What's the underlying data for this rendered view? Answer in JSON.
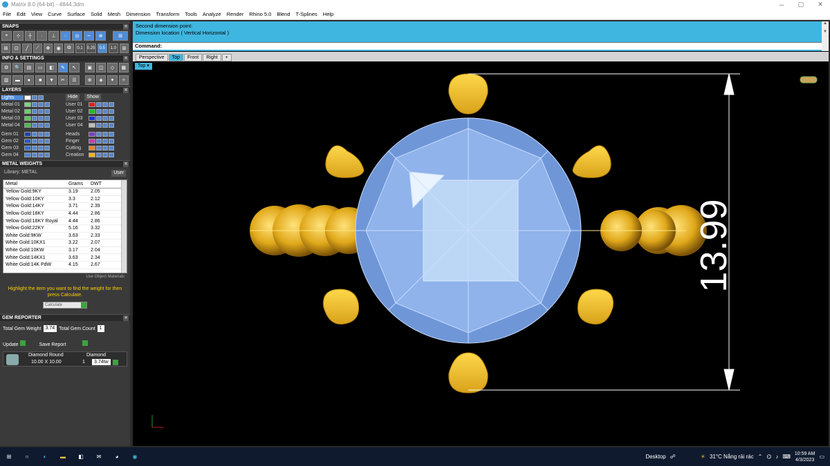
{
  "window": {
    "title": "Matrix 8.0 (64-bit) - 4844.3dm",
    "minimize": "─",
    "maximize": "▢",
    "close": "✕"
  },
  "menu": [
    "File",
    "Edit",
    "View",
    "Curve",
    "Surface",
    "Solid",
    "Mesh",
    "Dimension",
    "Transform",
    "Tools",
    "Analyze",
    "Render",
    "Rhino 5.0",
    "Blend",
    "T-Splines",
    "Help"
  ],
  "panels": {
    "snaps": {
      "title": "SNAPS",
      "values": [
        "0.1",
        "0.25",
        "0.5",
        "1.0"
      ]
    },
    "info": {
      "title": "INFO & SETTINGS"
    },
    "layers": {
      "title": "LAYERS",
      "lights": "Lights",
      "hide": "Hide",
      "show": "Show",
      "left": [
        {
          "name": "Metal 01",
          "color": "#7fd27f"
        },
        {
          "name": "Metal 02",
          "color": "#6ccf6c"
        },
        {
          "name": "Metal 03",
          "color": "#59c659"
        },
        {
          "name": "Metal 04",
          "color": "#4cbc4c"
        },
        {
          "name": "Gem 01",
          "color": "#1f3fc1"
        },
        {
          "name": "Gem 02",
          "color": "#2c58c9"
        },
        {
          "name": "Gem 03",
          "color": "#3a6fd2"
        },
        {
          "name": "Gem 04",
          "color": "#4f85db"
        }
      ],
      "right": [
        {
          "name": "User 01",
          "color": "#e02020"
        },
        {
          "name": "User 02",
          "color": "#20c020"
        },
        {
          "name": "User 03",
          "color": "#2030d0"
        },
        {
          "name": "User 04",
          "color": "#bdbdbd"
        },
        {
          "name": "Heads",
          "color": "#7b3fc4"
        },
        {
          "name": "Finger",
          "color": "#c23fb2"
        },
        {
          "name": "Cutting",
          "color": "#e8842a"
        },
        {
          "name": "Creation",
          "color": "#f2b21c"
        }
      ]
    },
    "metal_weights": {
      "title": "METAL WEIGHTS",
      "library_label": "Library: METAL",
      "user_btn": "User",
      "headers": [
        "Metal",
        "Grams",
        "DWT"
      ],
      "rows": [
        [
          "Yellow Gold:9KY",
          "3.19",
          "2.05"
        ],
        [
          "Yellow Gold:10KY",
          "3.3",
          "2.12"
        ],
        [
          "Yellow Gold:14KY",
          "3.71",
          "2.39"
        ],
        [
          "Yellow Gold:18KY",
          "4.44",
          "2.86"
        ],
        [
          "Yellow Gold:18KY Royal",
          "4.44",
          "2.86"
        ],
        [
          "Yellow Gold:22KY",
          "5.16",
          "3.32"
        ],
        [
          "White Gold:9KW",
          "3.63",
          "2.33"
        ],
        [
          "White Gold:10KX1",
          "3.22",
          "2.07"
        ],
        [
          "White Gold:10KW",
          "3.17",
          "2.04"
        ],
        [
          "White Gold:14KX1",
          "3.63",
          "2.34"
        ],
        [
          "White Gold:14K PdW",
          "4.15",
          "2.67"
        ]
      ],
      "use_object": "Use Object Materials",
      "hint": "Highlight the item you want to find the weight for then press Calculate.",
      "calculate": "Calculate"
    },
    "gem_reporter": {
      "title": "GEM REPORTER",
      "total_weight_label": "Total Gem Weight",
      "total_weight": "3.74",
      "total_count_label": "Total Gem Count",
      "total_count": "1",
      "update": "Update",
      "save_report": "Save Report",
      "gem": {
        "shape": "Diamond Round",
        "size": "10.00 X 10.00",
        "material": "Diamond",
        "count": "1",
        "weight": "3.74tw"
      }
    }
  },
  "command": {
    "line1": "Second dimension point:",
    "line2": "Dimension location ( Vertical  Horizontal )",
    "label": "Command:"
  },
  "viewport_tabs": [
    "Perspective",
    "Top",
    "Front",
    "Right",
    "+"
  ],
  "active_tab": "Top",
  "viewport_label": "Top",
  "dimension": {
    "value": "13.99"
  },
  "taskbar": {
    "desktop": "Desktop",
    "weather": "31°C  Nắng rải rác",
    "time": "10:59 AM",
    "date": "4/3/2023"
  },
  "colors": {
    "accent": "#3fb6e0",
    "gold": "#f4c430",
    "gem": "#7fa8e8"
  }
}
